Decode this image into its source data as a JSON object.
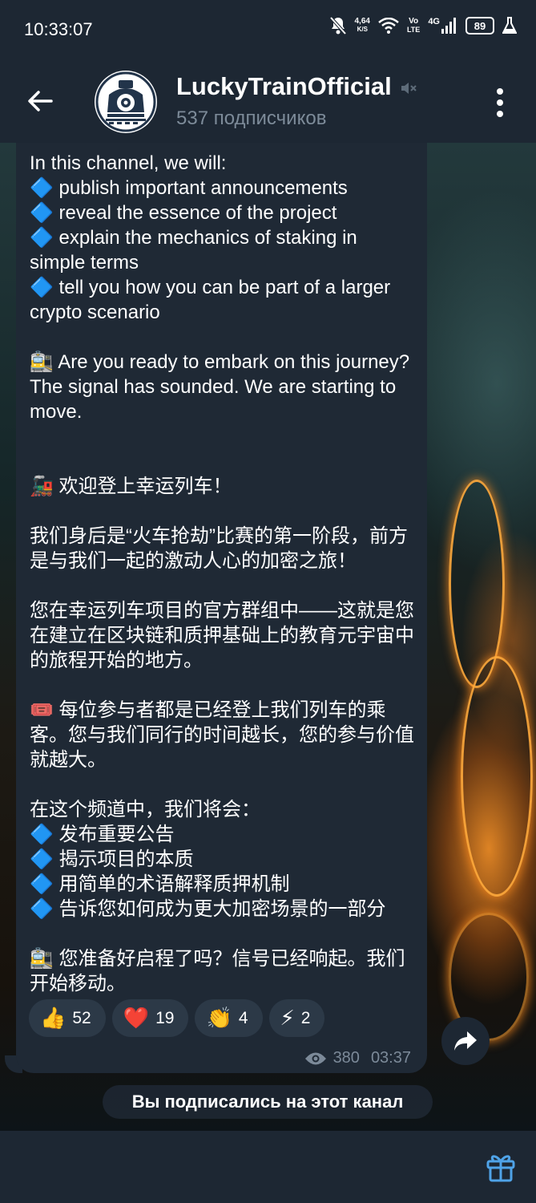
{
  "status_bar": {
    "time": "10:33:07",
    "net_speed": "4,64",
    "net_speed_unit": "K/S",
    "volte_top": "Vo",
    "volte_bottom": "LTE",
    "network": "4G",
    "battery": "89"
  },
  "header": {
    "channel_name": "LuckyTrainOfficial",
    "subscribers": "537 подписчиков"
  },
  "message": {
    "text": "In this channel, we will:\n🔷 publish important announcements\n🔷 reveal the essence of the project\n🔷 explain the mechanics of staking in simple terms\n🔷 tell you how you can be part of a larger crypto scenario\n\n🚉 Are you ready to embark on this journey? The signal has sounded. We are starting to move.\n\n\n🚂 欢迎登上幸运列车！\n\n我们身后是“火车抢劫”比赛的第一阶段，前方是与我们一起的激动人心的加密之旅！\n\n您在幸运列车项目的官方群组中——这就是您在建立在区块链和质押基础上的教育元宇宙中的旅程开始的地方。\n\n🎟️ 每位参与者都是已经登上我们列车的乘客。您与我们同行的时间越长，您的参与价值就越大。\n\n在这个频道中，我们将会：\n🔷 发布重要公告\n🔷 揭示项目的本质\n🔷 用简单的术语解释质押机制\n🔷 告诉您如何成为更大加密场景的一部分\n\n🚉 您准备好启程了吗？信号已经响起。我们开始移动。",
    "reactions": [
      {
        "emoji": "👍",
        "count": "52"
      },
      {
        "emoji": "❤️",
        "count": "19"
      },
      {
        "emoji": "👏",
        "count": "4"
      },
      {
        "emoji": "⚡",
        "count": "2"
      }
    ],
    "views": "380",
    "time": "03:37"
  },
  "service_message": "Вы подписались на этот канал",
  "colors": {
    "bar_bg": "#1d2733",
    "bubble_bg": "#1f2935",
    "muted_text": "#7d8b99",
    "accent_blue": "#4fa3e8"
  }
}
